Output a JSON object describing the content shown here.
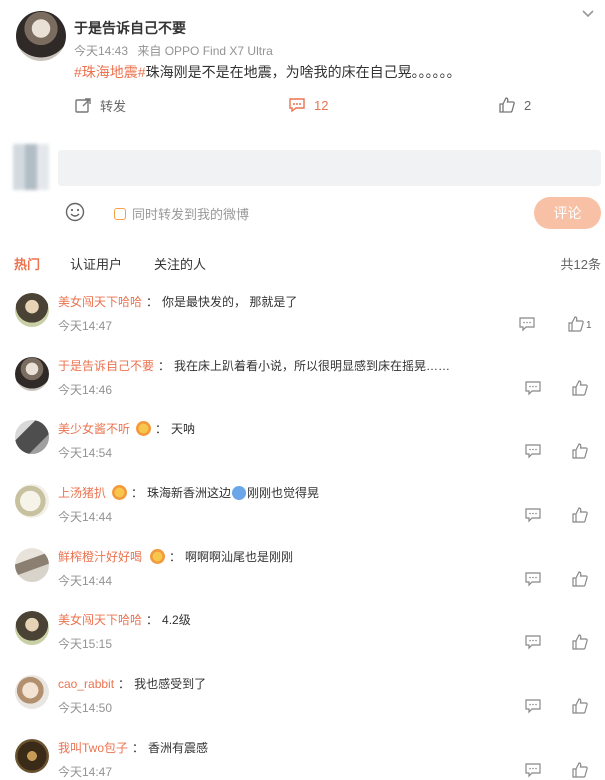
{
  "post": {
    "author": "于是告诉自己不要",
    "time": "今天14:43",
    "source": "来自 OPPO Find X7 Ultra",
    "topic": "#珠海地震#",
    "text": "珠海刚是不是在地震，为啥我的床在自己晃。。。。。。",
    "repost_label": "转发",
    "comment_count": "12",
    "like_count": "2"
  },
  "composer": {
    "placeholder": "",
    "share_label": "同时转发到我的微博",
    "submit_label": "评论"
  },
  "tabs": [
    "热门",
    "认证用户",
    "关注的人"
  ],
  "total": "共12条",
  "comments": [
    {
      "user": "美女闯天下哈哈",
      "text": "你是最快发的， 那就是了",
      "time": "今天14:47",
      "likes": "1"
    },
    {
      "user": "于是告诉自己不要",
      "text": "我在床上趴着看小说，所以很明显感到床在摇晃……",
      "time": "今天14:46",
      "likes": ""
    },
    {
      "user": "美少女酱不听",
      "text": "天呐",
      "time": "今天14:54",
      "likes": ""
    },
    {
      "user": "上汤猪扒",
      "text": "珠海新香洲这边",
      "text2": "刚刚也觉得晃",
      "time": "今天14:44",
      "likes": ""
    },
    {
      "user": "鲜榨橙汁好好喝",
      "text": "啊啊啊汕尾也是刚刚",
      "time": "今天14:44",
      "likes": ""
    },
    {
      "user": "美女闯天下哈哈",
      "text": "4.2级",
      "time": "今天15:15",
      "likes": ""
    },
    {
      "user": "cao_rabbit",
      "text": "我也感受到了",
      "time": "今天14:50",
      "likes": ""
    },
    {
      "user": "我叫Two包子",
      "text": "香洲有震感",
      "time": "今天14:47",
      "likes": ""
    }
  ],
  "colors": {
    "accent": "#eb7350",
    "muted": "#939393"
  },
  "icons": [
    "chevron-down-icon",
    "repost-icon",
    "comment-icon",
    "thumbs-up-icon",
    "emoji-icon",
    "reply-icon"
  ]
}
